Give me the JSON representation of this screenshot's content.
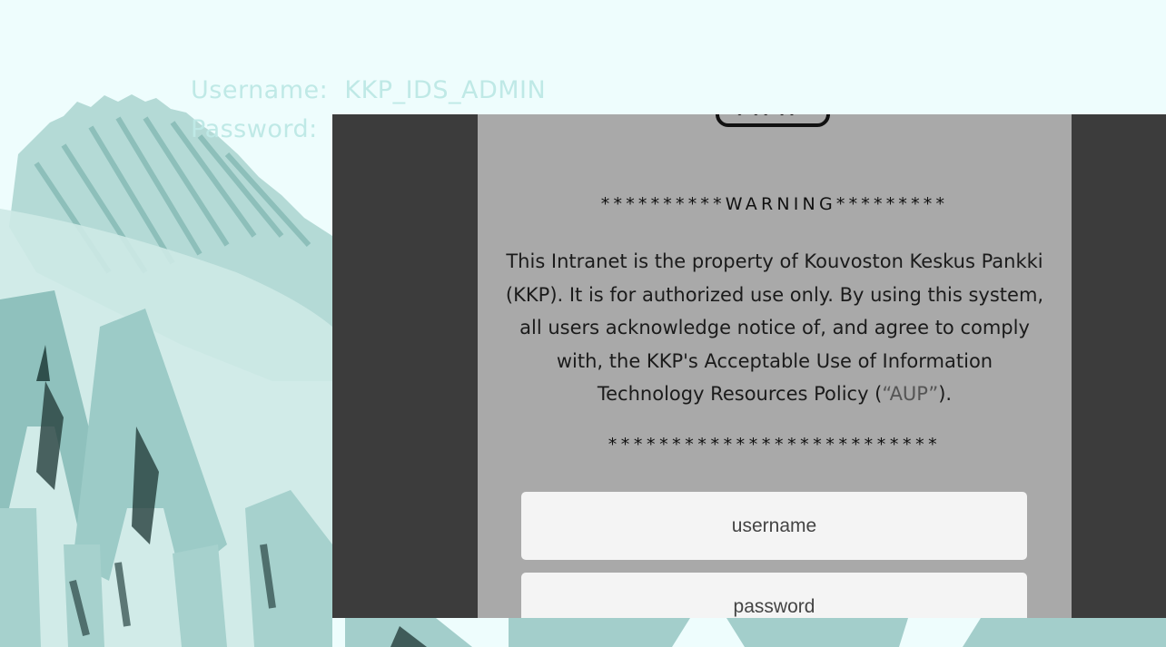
{
  "background": {
    "credentials": {
      "username_line": "Username:  KKP_IDS_ADMIN",
      "password_line": "Password:"
    }
  },
  "login": {
    "warning_heading": "**********WARNING*********",
    "notice_lines": [
      "This Intranet is the property of Kouvoston Keskus Pankki",
      "(KKP). It is for authorized use only. By using this system,",
      "all users acknowledge notice of, and agree to comply",
      "with, the KKP's Acceptable Use of Information"
    ],
    "notice_last_prefix": "Technology Resources Policy (",
    "aup_link": "“AUP”",
    "notice_last_suffix": ").",
    "stars_footer": "**************************",
    "username_placeholder": "username",
    "password_placeholder": "password"
  },
  "colors": {
    "page_background": "#eefdfd",
    "art_teal": "#9cc9c6",
    "overlay_dark": "#3c3c3c",
    "panel_gray": "#a9a9a9",
    "field_bg": "#f4f4f4"
  }
}
